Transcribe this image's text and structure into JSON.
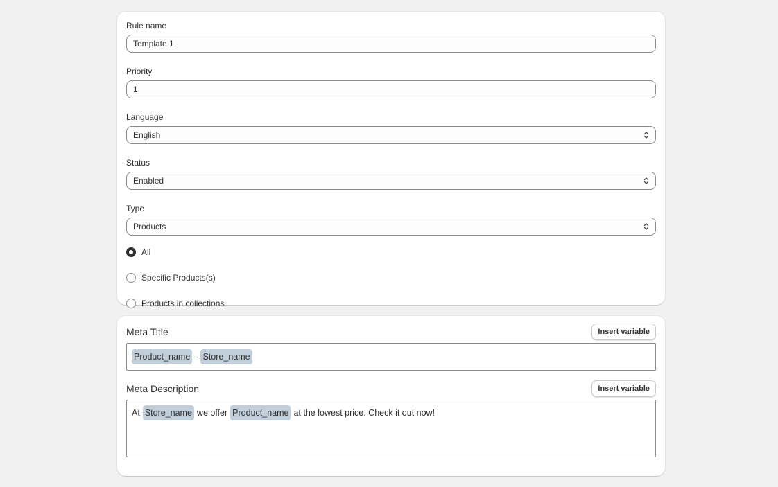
{
  "rule_form": {
    "rule_name": {
      "label": "Rule name",
      "value": "Template 1"
    },
    "priority": {
      "label": "Priority",
      "value": "1"
    },
    "language": {
      "label": "Language",
      "value": "English"
    },
    "status": {
      "label": "Status",
      "value": "Enabled"
    },
    "type": {
      "label": "Type",
      "value": "Products"
    },
    "scope_options": [
      {
        "label": "All",
        "checked": true
      },
      {
        "label": "Specific Products(s)",
        "checked": false
      },
      {
        "label": "Products in collections",
        "checked": false
      }
    ]
  },
  "meta": {
    "title_section": {
      "heading": "Meta Title",
      "insert_button": "Insert variable",
      "tokens": [
        {
          "kind": "tag",
          "text": "Product_name"
        },
        {
          "kind": "text",
          "text": "-"
        },
        {
          "kind": "tag",
          "text": "Store_name"
        }
      ]
    },
    "description_section": {
      "heading": "Meta Description",
      "insert_button": "Insert variable",
      "tokens": [
        {
          "kind": "text",
          "text": "At"
        },
        {
          "kind": "tag",
          "text": "Store_name"
        },
        {
          "kind": "text",
          "text": "we offer"
        },
        {
          "kind": "tag",
          "text": "Product_name"
        },
        {
          "kind": "text",
          "text": "at the lowest price. Check it out now!"
        }
      ]
    }
  },
  "colors": {
    "page_bg": "#f1f1f1",
    "card_bg": "#ffffff",
    "tag_bg": "#c1cfdb",
    "border": "#8a8a8a",
    "text": "#303030"
  }
}
